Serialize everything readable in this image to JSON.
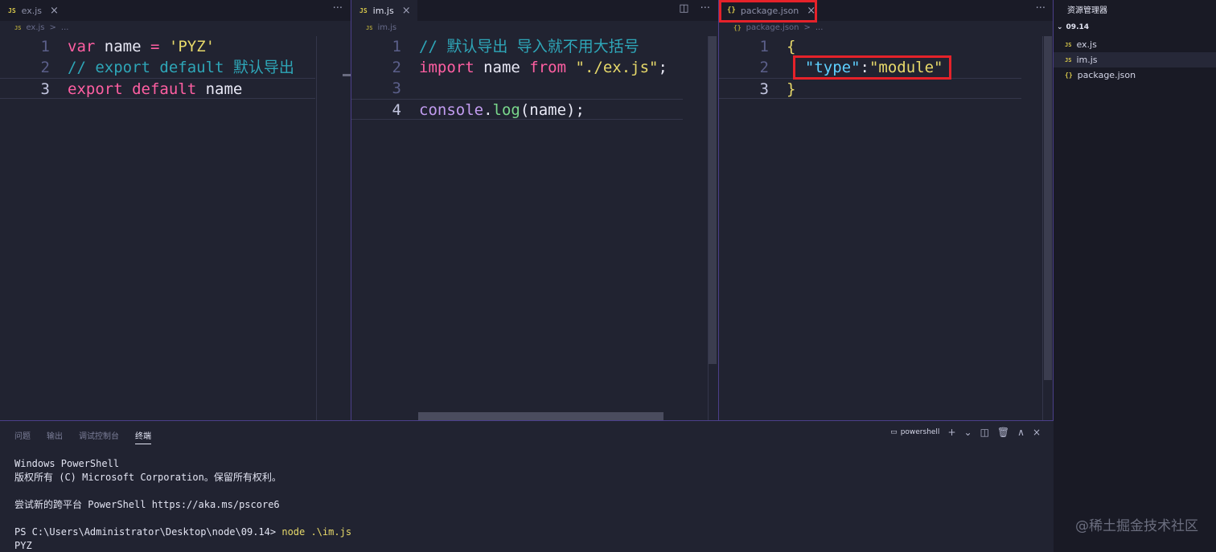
{
  "panes": [
    {
      "tab": {
        "icon": "JS",
        "label": "ex.js",
        "close": "×"
      },
      "crumb": {
        "icon": "JS",
        "file": "ex.js",
        "sep": ">",
        "more": "..."
      },
      "tools": {
        "more": "···"
      },
      "lines": [
        {
          "n": "1",
          "tokens": [
            {
              "t": "var",
              "c": "k-pink"
            },
            {
              "t": " name ",
              "c": "k-white"
            },
            {
              "t": "=",
              "c": "k-pink"
            },
            {
              "t": " ",
              "c": "k-white"
            },
            {
              "t": "'PYZ'",
              "c": "k-yellow"
            }
          ]
        },
        {
          "n": "2",
          "tokens": [
            {
              "t": "// export default 默认导出",
              "c": "k-comment"
            }
          ]
        },
        {
          "n": "3",
          "cur": true,
          "tokens": [
            {
              "t": "export",
              "c": "k-pink"
            },
            {
              "t": " ",
              "c": "k-white"
            },
            {
              "t": "default",
              "c": "k-pink"
            },
            {
              "t": " name",
              "c": "k-white"
            }
          ]
        }
      ]
    },
    {
      "tab": {
        "icon": "JS",
        "label": "im.js",
        "close": "×"
      },
      "crumb": {
        "icon": "JS",
        "file": "im.js"
      },
      "tools": {
        "split": "◫",
        "more": "···"
      },
      "lines": [
        {
          "n": "1",
          "tokens": [
            {
              "t": "// 默认导出 导入就不用大括号",
              "c": "k-comment"
            }
          ]
        },
        {
          "n": "2",
          "tokens": [
            {
              "t": "import",
              "c": "k-pink"
            },
            {
              "t": " name ",
              "c": "k-white"
            },
            {
              "t": "from",
              "c": "k-pink"
            },
            {
              "t": " ",
              "c": "k-white"
            },
            {
              "t": "\"./ex.js\"",
              "c": "k-yellow"
            },
            {
              "t": ";",
              "c": "k-white"
            }
          ]
        },
        {
          "n": "3",
          "tokens": []
        },
        {
          "n": "4",
          "cur": true,
          "tokens": [
            {
              "t": "console",
              "c": "k-purple"
            },
            {
              "t": ".",
              "c": "k-white"
            },
            {
              "t": "log",
              "c": "k-green"
            },
            {
              "t": "(name);",
              "c": "k-white"
            }
          ]
        }
      ]
    },
    {
      "tab": {
        "icon": "{}",
        "label": "package.json",
        "close": "×"
      },
      "crumb": {
        "icon": "{}",
        "file": "package.json",
        "sep": ">",
        "more": "..."
      },
      "tools": {
        "more": "···"
      },
      "lines": [
        {
          "n": "1",
          "tokens": [
            {
              "t": "{",
              "c": "k-yellow"
            }
          ]
        },
        {
          "n": "2",
          "tokens": [
            {
              "t": "  ",
              "c": "k-white"
            },
            {
              "t": "\"type\"",
              "c": "k-cyan"
            },
            {
              "t": ":",
              "c": "k-white"
            },
            {
              "t": "\"module\"",
              "c": "k-yellow"
            }
          ]
        },
        {
          "n": "3",
          "cur": true,
          "tokens": [
            {
              "t": "}",
              "c": "k-yellow"
            }
          ]
        }
      ]
    }
  ],
  "explorer": {
    "title": "资源管理器",
    "folder": "09.14",
    "files": [
      {
        "icon": "JS",
        "name": "ex.js"
      },
      {
        "icon": "JS",
        "name": "im.js",
        "selected": true
      },
      {
        "icon": "{}",
        "name": "package.json"
      }
    ]
  },
  "terminal": {
    "tabs": [
      "问题",
      "输出",
      "调试控制台",
      "终端"
    ],
    "active_tab": "终端",
    "shell": "powershell",
    "toolbar": {
      "add": "+",
      "dropdown": "⌄",
      "split": "◫",
      "trash": "🗑",
      "maximize": "∧",
      "close": "×"
    },
    "lines": [
      "Windows PowerShell",
      "版权所有 (C) Microsoft Corporation。保留所有权利。",
      "",
      "尝试新的跨平台 PowerShell https://aka.ms/pscore6",
      "",
      {
        "prompt": "PS C:\\Users\\Administrator\\Desktop\\node\\09.14> ",
        "cmd": "node .\\im.js"
      },
      "PYZ"
    ]
  },
  "watermark": "@稀土掘金技术社区"
}
